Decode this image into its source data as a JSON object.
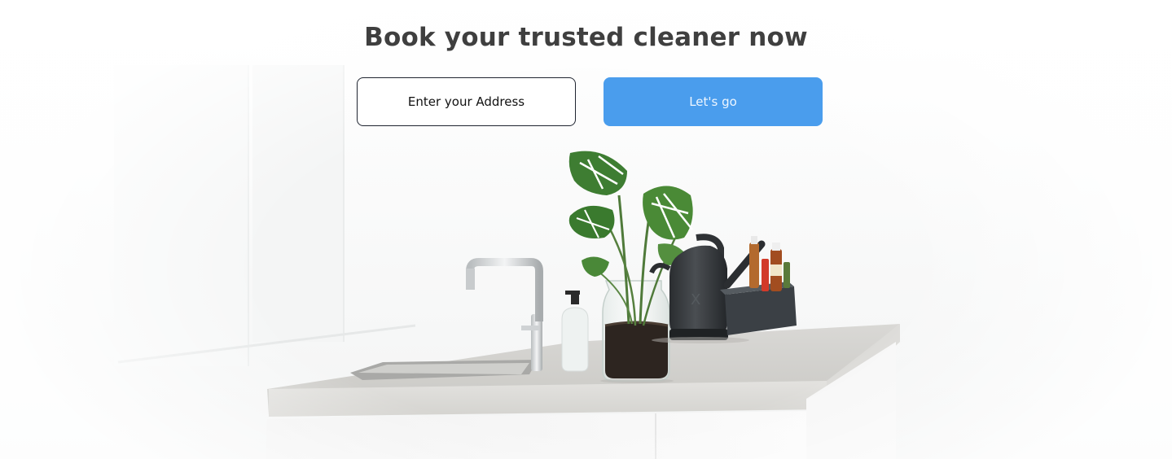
{
  "hero": {
    "headline": "Book your trusted cleaner now",
    "background_image": "kitchen counter with sink, potted monstera plant in glass jar, soap dispenser, black watering can and condiment caddy"
  },
  "search": {
    "address_placeholder": "Enter your Address",
    "address_value": "",
    "submit_label": "Let's go"
  },
  "colors": {
    "headline_text": "#3f3f3f",
    "button_bg": "#4a9ded",
    "button_text": "#eef6ff",
    "field_border": "#1f2430"
  }
}
